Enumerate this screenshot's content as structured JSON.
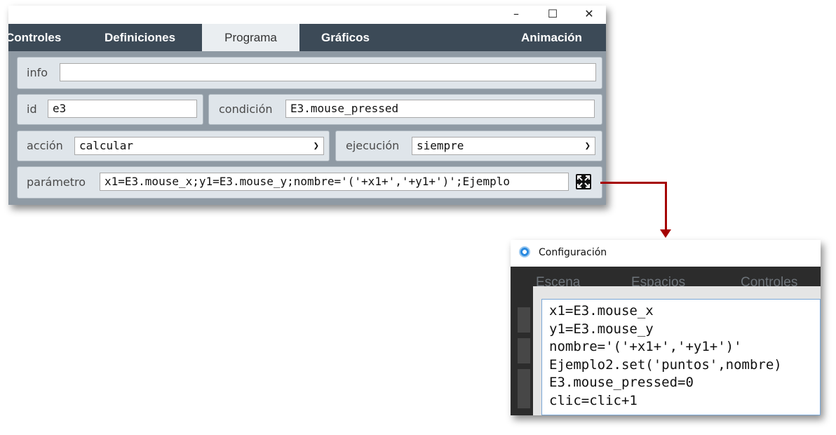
{
  "main_window": {
    "window_controls": {
      "minimize": "–",
      "maximize": "☐",
      "close": "✕"
    },
    "tabs": [
      "Controles",
      "Definiciones",
      "Programa",
      "Gráficos",
      "Animación"
    ],
    "active_tab": "Programa",
    "form": {
      "info_label": "info",
      "info_value": "",
      "id_label": "id",
      "id_value": "e3",
      "condicion_label": "condición",
      "condicion_value": "E3.mouse_pressed",
      "accion_label": "acción",
      "accion_value": "calcular",
      "ejecucion_label": "ejecución",
      "ejecucion_value": "siempre",
      "parametro_label": "parámetro",
      "parametro_value": "x1=E3.mouse_x;y1=E3.mouse_y;nombre='('+x1+','+y1+')';Ejemplo"
    }
  },
  "config_window": {
    "title": "Configuración",
    "tabs": [
      "Escena",
      "Espacios",
      "Controles"
    ],
    "editor_lines": [
      "x1=E3.mouse_x",
      "y1=E3.mouse_y",
      "nombre='('+x1+','+y1+')'",
      "Ejemplo2.set('puntos',nombre)",
      "E3.mouse_pressed=0",
      "clic=clic+1"
    ]
  },
  "colors": {
    "tab_bar": "#3c4a57",
    "content_bg": "#8f9aa4",
    "panel_bg": "#dfe5ea",
    "connector": "#a50000",
    "config_dark": "#2c2c2c"
  },
  "icons": {
    "expand": "expand-icon",
    "config_app": "app-icon",
    "chevron": "chevron-down-icon"
  }
}
